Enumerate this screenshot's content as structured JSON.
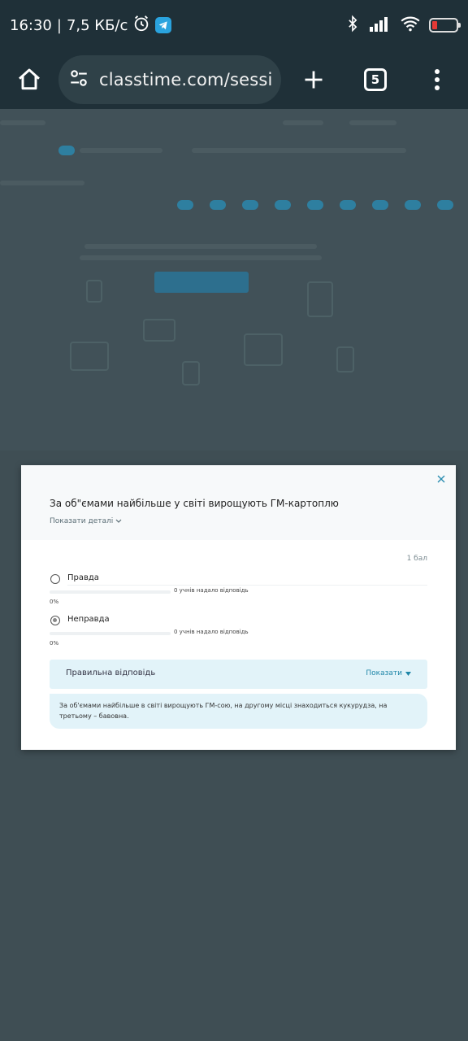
{
  "status_bar": {
    "time": "16:30",
    "network_speed": "7,5 КБ/с",
    "icons": [
      "alarm-icon",
      "telegram-icon",
      "bluetooth-icon",
      "signal-icon",
      "wifi-icon",
      "battery-icon"
    ]
  },
  "browser": {
    "url": "classtime.com/sessio",
    "tab_count": "5"
  },
  "modal": {
    "question": "За об\"ємами найбільше у світі вирощують ГМ-картоплю",
    "details_label": "Показати деталі",
    "points": "1 бал",
    "options": [
      {
        "label": "Правда",
        "responses": "0 учнів надало відповідь",
        "percent": "0%",
        "fill": 0,
        "checked": false
      },
      {
        "label": "Неправда",
        "responses": "0 учнів надало відповідь",
        "percent": "0%",
        "fill": 0,
        "checked": true
      }
    ],
    "correct_answer_label": "Правильна відповідь",
    "show_label": "Показати",
    "explanation": "За об'ємами найбільше в світі вирощують ГМ-сою, на другому місці знаходиться кукурудза, на третьому – бавовна."
  },
  "colors": {
    "accent": "#1f86a8",
    "answer_bg": "#e2f3f9",
    "overlay": "#3f4e54"
  }
}
